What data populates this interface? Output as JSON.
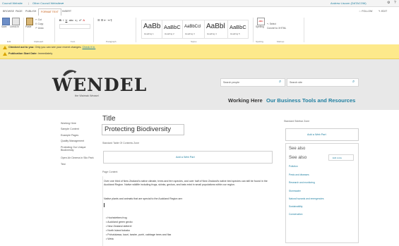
{
  "suite": {
    "site": "Council Website",
    "other_site": "Other Council Websites",
    "user": "Andrew Liscom (DATACOM)",
    "gear_label": "Settings",
    "help_label": "?"
  },
  "tabs": [
    "BROWSE",
    "PAGE",
    "PUBLISH",
    "FORMAT TEXT",
    "INSERT"
  ],
  "tabs_right": {
    "follow": "FOLLOW",
    "edit": "EDIT"
  },
  "ribbon": {
    "save": "Save",
    "check_in": "Check In",
    "paste": "Paste",
    "cut": "Cut",
    "copy": "Copy",
    "undo": "Undo",
    "groups": [
      "Edit",
      "Clipboard",
      "Font",
      "Paragraph",
      "Styles",
      "Spelling",
      "Markup"
    ],
    "styles": [
      {
        "sample": "AaBb",
        "name": "Heading 1"
      },
      {
        "sample": "AaBbC",
        "name": "Heading 2"
      },
      {
        "sample": "AaBbCcl",
        "name": "Heading 3"
      },
      {
        "sample": "AaBbl",
        "name": "Heading 4"
      },
      {
        "sample": "AaBbC",
        "name": "Heading 5"
      }
    ],
    "spelling": "Spelling",
    "select": "Select",
    "convert": "Convert to XHTML"
  },
  "notice": {
    "line1_strong": "Checked out to you:",
    "line1_rest": "Only you can see your recent changes.",
    "line1_link": "Check it in.",
    "line2_strong": "Publication Start Date:",
    "line2_rest": "Immediately"
  },
  "header": {
    "logo": "WENDEL",
    "tagline": "the Waimak Weasel",
    "search_people": "Search people",
    "search_site": "Search site",
    "nav": [
      "Working Here",
      "Our Business",
      "Tools and Resources"
    ]
  },
  "left_nav": [
    "Working Here",
    "Sample Content",
    "Example Pages",
    "Quality Management",
    "Protecting Our Unique Biodiversity",
    "Open Air Cinema in Silo Park",
    "Test"
  ],
  "main": {
    "title_label": "Title",
    "title_value": "Protecting Biodiversity",
    "toc_zone": "Standard Table Of Contents Zone",
    "add_web_part": "Add a Web Part",
    "page_content": "Page Content",
    "para1": "Over one third of New Zealand's native climate, trees and fern species, and over half of New Zealand's native bird species can still be found in the Auckland Region. Native wildlife including frogs, skinks, geckos, and bats exist in small populations within our region.",
    "para2": "Native plants and animals that are special to the Auckland Region are:",
    "bullets": [
      "Hochstetters frog",
      "Auckland green gecko",
      "New Zealand dotterel",
      "North Island kokako",
      "Pohutukawa, kauri, taraire, puriri, cabbage trees and flax",
      "Weta"
    ]
  },
  "sidebar": {
    "zone": "Standard Sidebar Zone",
    "add_web_part": "Add a Web Part",
    "see_also_1": "See also",
    "see_also_2": "See also",
    "edit_links": "Edit Links",
    "links": [
      "Pollution",
      "Pests and diseases",
      "Research and monitoring",
      "Stormwater",
      "Natural hazards and emergencies",
      "Sustainability",
      "Conservation"
    ]
  }
}
